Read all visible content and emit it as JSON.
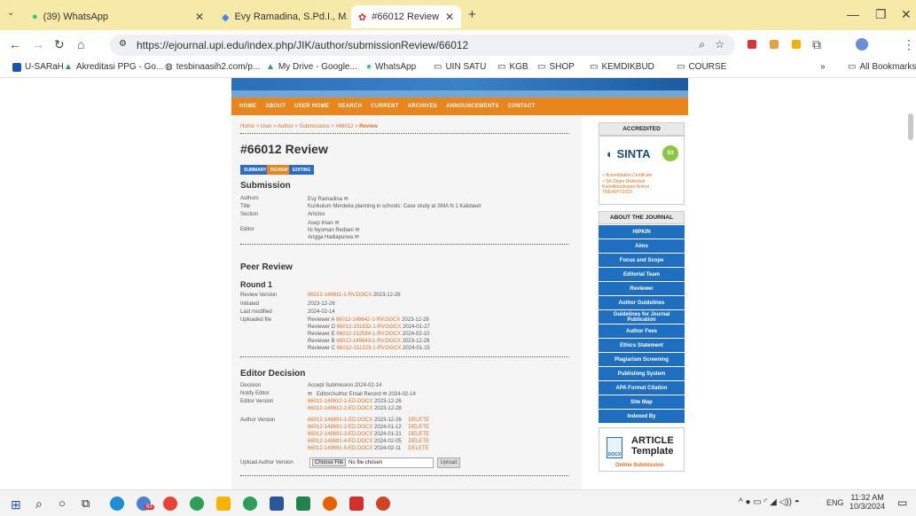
{
  "browser": {
    "tabs": [
      {
        "title": "(39) WhatsApp",
        "icon": "whatsapp-icon"
      },
      {
        "title": "Evy Ramadina, S.Pd.I., M.Pd. - G",
        "icon": "scholar-icon"
      },
      {
        "title": "#66012 Review",
        "icon": "journal-icon"
      }
    ],
    "new_tab": "+",
    "url": "https://ejournal.upi.edu/index.php/JIK/author/submissionReview/66012",
    "bookmarks": [
      "U-SARaH",
      "Akreditasi PPG - Go...",
      "tesbinaasih2.com/p...",
      "My Drive - Google...",
      "WhatsApp",
      "UIN SATU",
      "KGB",
      "SHOP",
      "KEMDIKBUD",
      "COURSE"
    ],
    "all_bookmarks": "All Bookmarks",
    "more": "»"
  },
  "menu": [
    "HOME",
    "ABOUT",
    "USER HOME",
    "SEARCH",
    "CURRENT",
    "ARCHIVES",
    "ANNOUNCEMENTS",
    "CONTACT"
  ],
  "breadcrumb": "Home > User > Author > Submissions > #66012 > ",
  "breadcrumb_current": "Review",
  "title": "#66012 Review",
  "subtabs": [
    "SUMMARY",
    "REVIEW",
    "EDITING"
  ],
  "submission": {
    "heading": "Submission",
    "authors_label": "Authors",
    "authors": "Evy Ramadina",
    "title_label": "Title",
    "title": "Kurikulum Merdeka planning in schools: Case study at SMA N 1 Kalidawir",
    "section_label": "Section",
    "section": "Articles",
    "editor_label": "Editor",
    "editors": [
      "Asep Iman",
      "Ni Nyoman Rediani",
      "Angga Hadiapurwa"
    ]
  },
  "peer_review": {
    "heading": "Peer Review",
    "round": "Round 1",
    "review_version_label": "Review Version",
    "review_version_file": "66012-149611-1-RV.DOCX",
    "review_version_date": "2023-12-26",
    "initiated_label": "Initiated",
    "initiated": "2023-12-26",
    "last_modified_label": "Last modified",
    "last_modified": "2024-02-14",
    "uploaded_label": "Uploaded file",
    "uploads": [
      {
        "who": "Reviewer A",
        "file": "66012-149642-1-RV.DOCX",
        "date": "2023-12-28"
      },
      {
        "who": "Reviewer D",
        "file": "66012-151832-1-RV.DOCX",
        "date": "2024-01-27"
      },
      {
        "who": "Reviewer E",
        "file": "66012-152584-1-RV.DOCX",
        "date": "2024-02-10"
      },
      {
        "who": "Reviewer B",
        "file": "66012-149643-1-RV.DOCX",
        "date": "2023-12-28"
      },
      {
        "who": "Reviewer C",
        "file": "66012-151223-1-RV.DOCX",
        "date": "2024-01-15"
      }
    ]
  },
  "editor_decision": {
    "heading": "Editor Decision",
    "decision_label": "Decision",
    "decision": "Accept Submission 2024-02-14",
    "notify_label": "Notify Editor",
    "notify": "Editor/Author Email Record",
    "notify_date": "2024-02-14",
    "editor_version_label": "Editor Version",
    "editor_versions": [
      {
        "file": "66012-149612-1-ED.DOCX",
        "date": "2023-12-26"
      },
      {
        "file": "66012-149612-2-ED.DOCX",
        "date": "2023-12-28"
      }
    ],
    "author_version_label": "Author Version",
    "author_versions": [
      {
        "file": "66012-149691-1-ED.DOCX",
        "date": "2023-12-26"
      },
      {
        "file": "66012-149691-2-ED.DOCX",
        "date": "2024-01-12"
      },
      {
        "file": "66012-149691-3-ED.DOCX",
        "date": "2024-01-21"
      },
      {
        "file": "66012-149691-4-ED.DOCX",
        "date": "2024-02-05"
      },
      {
        "file": "66012-149691-5-ED.DOCX",
        "date": "2024-02-11"
      }
    ],
    "delete_label": "DELETE",
    "upload_label": "Upload Author Version",
    "choose_file": "Choose File",
    "no_file": "No file chosen",
    "upload_button": "Upload"
  },
  "sidebar": {
    "accredited": "ACCREDITED",
    "sinta": "SINTA",
    "sinta_badge": "S3",
    "links": [
      "» Accreditation Certificate",
      "» SK Dirjen Diktiristek Kemdikbudristek Nomor 79/E/KPT/2023"
    ],
    "about": "ABOUT THE JOURNAL",
    "items": [
      "HIPKIN",
      "Aims",
      "Focus and Scope",
      "Editorial Team",
      "Reviewer",
      "Author Guidelines",
      "Guidelines for Journal Publication",
      "Author Fees",
      "Ethics Statement",
      "Plagiarism Screening",
      "Publishing System",
      "APA Format Citation",
      "Site Map",
      "Indexed By"
    ],
    "article": "ARTICLE",
    "template": "Template",
    "docx": "DOCX",
    "online_submission": "Online Submission"
  },
  "taskbar": {
    "time": "11:32 AM",
    "date": "10/3/2024",
    "lang": "ENG",
    "badge": "63"
  }
}
